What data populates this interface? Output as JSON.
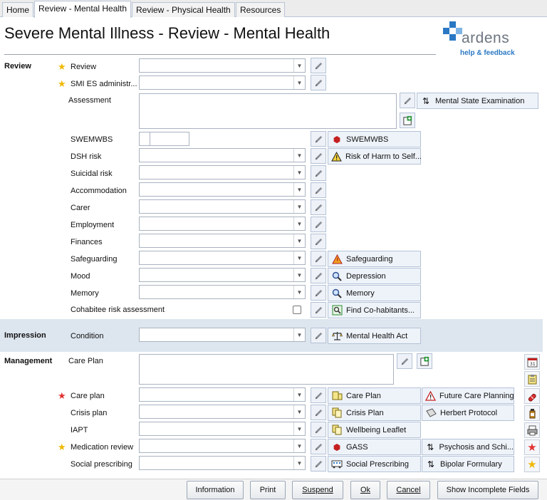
{
  "tabs": [
    "Home",
    "Review - Mental Health",
    "Review - Physical Health",
    "Resources"
  ],
  "title": "Severe Mental Illness - Review - Mental Health",
  "logo": {
    "word": "ardens",
    "subtitle": "help & feedback"
  },
  "colors": {
    "accent": "#2a78c4",
    "star_required": "#f0b800",
    "star_important": "#e23030",
    "band": "#dde5ee"
  },
  "sections": {
    "review": "Review",
    "impression": "Impression",
    "management": "Management"
  },
  "review_fields": {
    "review": "Review",
    "smi_es": "SMI ES administr...",
    "assessment": "Assessment",
    "swemwbs": "SWEMWBS",
    "dsh_risk": "DSH risk",
    "suicidal_risk": "Suicidal risk",
    "accommodation": "Accommodation",
    "carer": "Carer",
    "employment": "Employment",
    "finances": "Finances",
    "safeguarding": "Safeguarding",
    "mood": "Mood",
    "memory": "Memory",
    "cohabitee": "Cohabitee risk assessment"
  },
  "impression_fields": {
    "condition": "Condition"
  },
  "management_fields": {
    "care_plan_text": "Care Plan",
    "care_plan": "Care plan",
    "crisis_plan": "Crisis plan",
    "iapt": "IAPT",
    "medication_review": "Medication review",
    "social_prescribing": "Social prescribing"
  },
  "links": {
    "mse": "Mental State Examination",
    "swemwbs": "SWEMWBS",
    "risk_harm": "Risk of Harm to Self...",
    "safeguarding": "Safeguarding",
    "depression": "Depression",
    "memory": "Memory",
    "find_cohab": "Find Co-habitants...",
    "mha": "Mental Health Act",
    "care_plan": "Care Plan",
    "future_care": "Future Care Planning",
    "crisis_plan": "Crisis Plan",
    "herbert": "Herbert Protocol",
    "wellbeing": "Wellbeing Leaflet",
    "gass": "GASS",
    "psychosis": "Psychosis and Schi...",
    "social_pres": "Social Prescribing",
    "bipolar": "Bipolar Formulary"
  },
  "buttons": {
    "information": "Information",
    "print": "Print",
    "suspend": "Suspend",
    "ok": "Ok",
    "cancel": "Cancel",
    "show_incomplete": "Show Incomplete Fields"
  }
}
